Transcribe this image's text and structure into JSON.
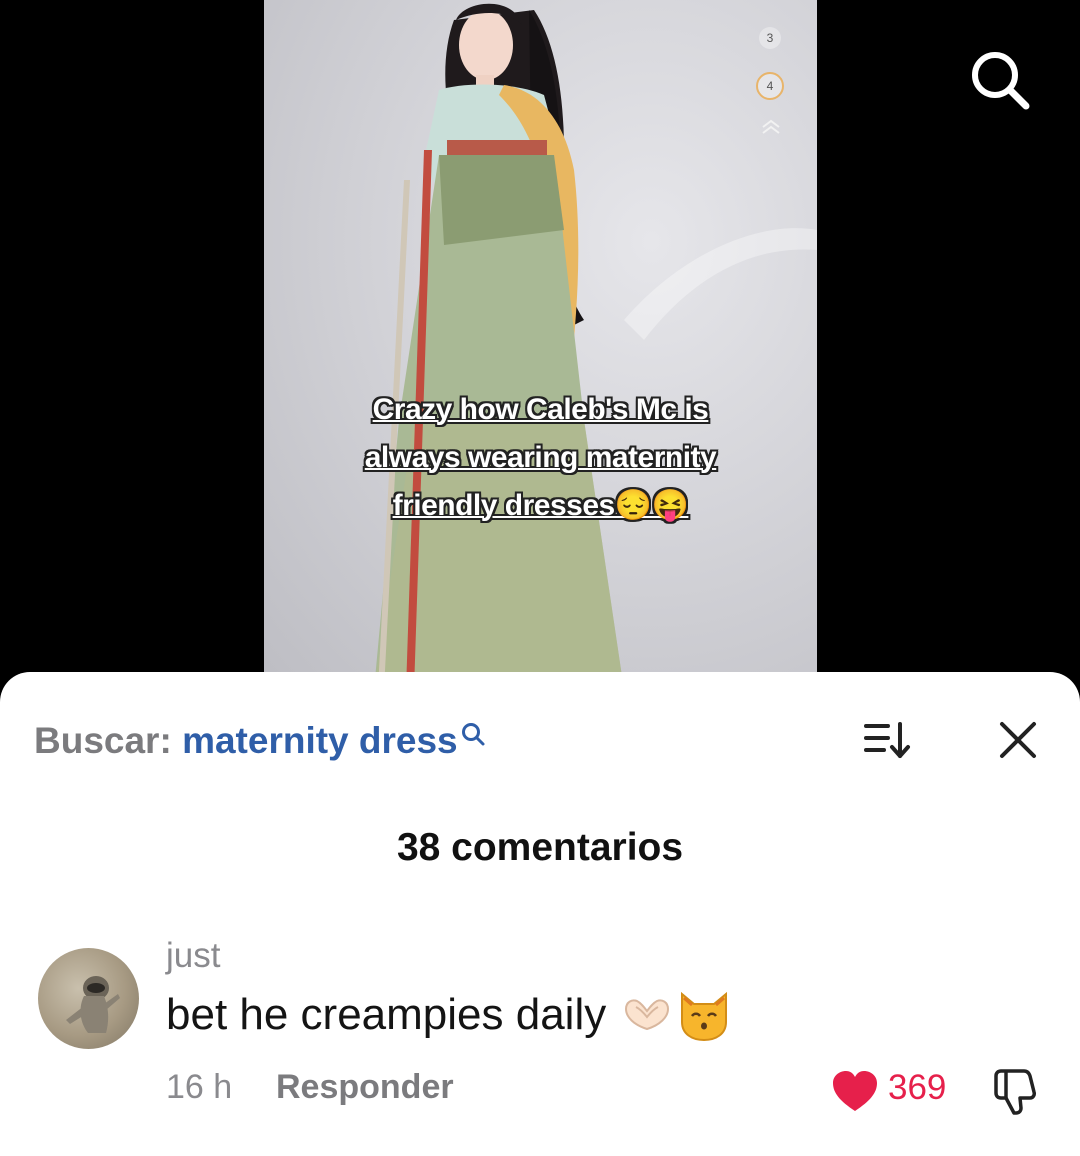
{
  "video": {
    "caption_lines": [
      "Crazy how Caleb's Mc is",
      "always wearing maternity",
      "friendly dresses😔😝"
    ],
    "page_indicator": {
      "prev": "3",
      "current": "4"
    }
  },
  "icons": {
    "top_search": "search-icon",
    "sort": "sort-icon",
    "close": "close-icon",
    "like": "heart-icon",
    "dislike": "thumbs-down-icon"
  },
  "comments_panel": {
    "search_prefix": "Buscar: ",
    "search_term": "maternity dress",
    "count_label": "38 comentarios",
    "comments": [
      {
        "username": "just",
        "text": "bet he creampies daily",
        "emojis": [
          "heart-hands",
          "kissing-cat"
        ],
        "time": "16 h",
        "reply_label": "Responder",
        "likes": "369",
        "liked": true
      }
    ]
  },
  "colors": {
    "accent_blue": "#2f5ea8",
    "like_red": "#e6204b",
    "muted_text": "#8a8a8e"
  }
}
